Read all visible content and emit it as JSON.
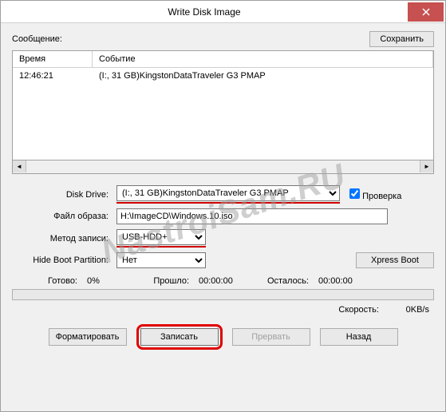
{
  "window": {
    "title": "Write Disk Image"
  },
  "log": {
    "message_label": "Сообщение:",
    "save_button": "Сохранить",
    "columns": [
      "Время",
      "Событие"
    ],
    "rows": [
      {
        "time": "12:46:21",
        "event": "(I:, 31 GB)KingstonDataTraveler G3 PMAP"
      }
    ]
  },
  "form": {
    "disk_drive": {
      "label": "Disk Drive:",
      "value": "(I:, 31 GB)KingstonDataTraveler G3 PMAP"
    },
    "verify_label": "Проверка",
    "image_file": {
      "label": "Файл образа:",
      "value": "H:\\ImageCD\\Windows.10.iso"
    },
    "write_method": {
      "label": "Метод записи:",
      "value": "USB-HDD+"
    },
    "hide_boot": {
      "label": "Hide Boot Partition:",
      "value": "Нет"
    },
    "xpress_boot": "Xpress Boot"
  },
  "status": {
    "ready_label": "Готово:",
    "percent": "0%",
    "elapsed_label": "Прошло:",
    "elapsed_value": "00:00:00",
    "remaining_label": "Осталось:",
    "remaining_value": "00:00:00",
    "speed_label": "Скорость:",
    "speed_value": "0KB/s"
  },
  "buttons": {
    "format": "Форматировать",
    "write": "Записать",
    "abort": "Прервать",
    "back": "Назад"
  },
  "watermark": "NastroiSam.RU"
}
